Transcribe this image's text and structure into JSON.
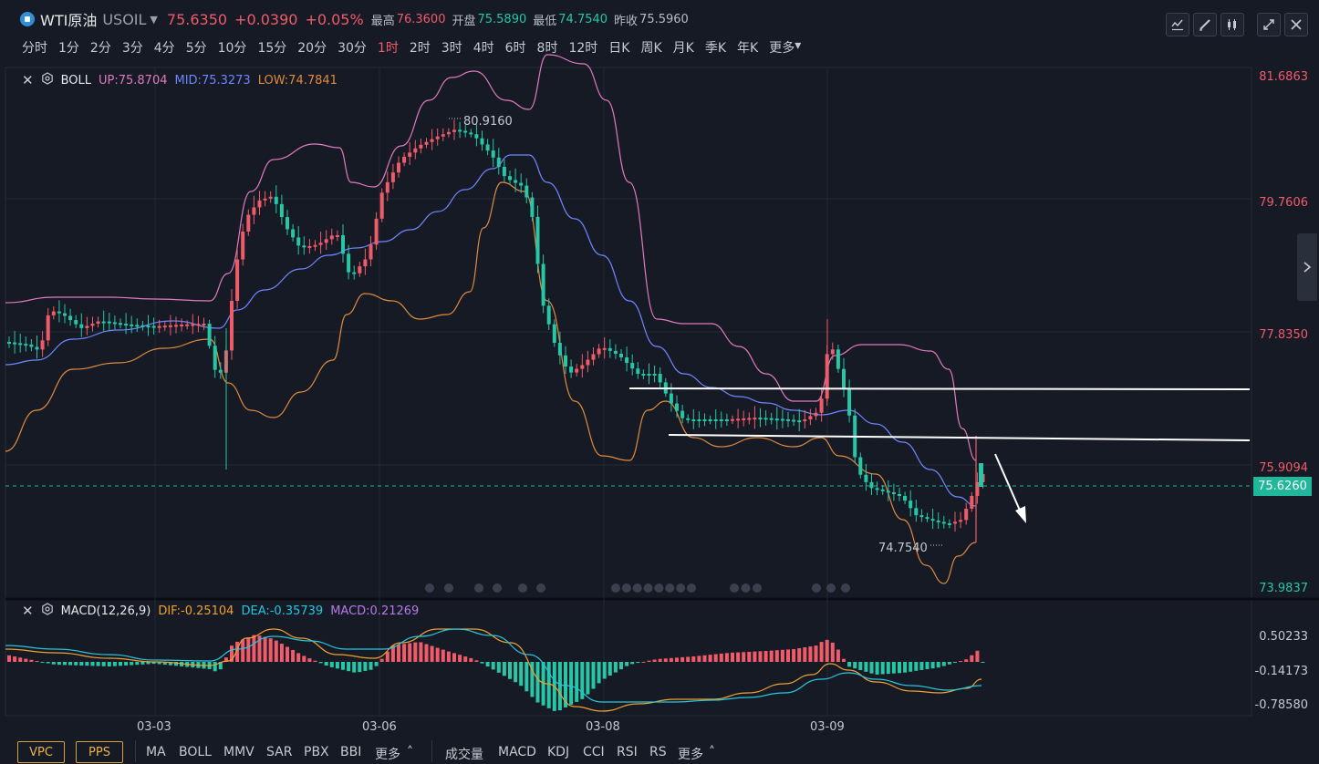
{
  "header": {
    "symbol_name": "WTI原油",
    "symbol_code": "USOIL",
    "price": "75.6350",
    "change": "+0.0390",
    "change_pct": "+0.05%",
    "high_label": "最高",
    "high_value": "76.3600",
    "open_label": "开盘",
    "open_value": "75.5890",
    "low_label": "最低",
    "low_value": "74.7540",
    "prev_close_label": "昨收",
    "prev_close_value": "75.5960"
  },
  "periods": [
    "分时",
    "1分",
    "2分",
    "3分",
    "4分",
    "5分",
    "10分",
    "15分",
    "20分",
    "30分",
    "1时",
    "2时",
    "3时",
    "4时",
    "6时",
    "8时",
    "12时",
    "日K",
    "周K",
    "月K",
    "季K",
    "年K",
    "更多"
  ],
  "active_period": "1时",
  "toolbar_icons": [
    "chart-type-icon",
    "draw-icon",
    "candle-settings-icon",
    "fullscreen-icon",
    "close-icon"
  ],
  "boll": {
    "name": "BOLL",
    "up": "UP:75.8704",
    "mid": "MID:75.3273",
    "low": "LOW:74.7841",
    "up_color": "#e07ac0",
    "mid_color": "#6f86ff",
    "low_color": "#e08a3c"
  },
  "price_axis": [
    "81.6863",
    "79.7606",
    "77.8350",
    "75.9094",
    "73.9837"
  ],
  "current_price_tag": "75.6260",
  "annotations": {
    "high_mark": "80.9160",
    "low_mark": "74.7540"
  },
  "macd": {
    "name": "MACD(12,26,9)",
    "dif": "DIF:-0.25104",
    "dea": "DEA:-0.35739",
    "macd": "MACD:0.21269",
    "dif_color": "#f0a030",
    "dea_color": "#26c6e0",
    "macd_color": "#b57be8",
    "axis": [
      "0.50233",
      "-0.14173",
      "-0.78580"
    ]
  },
  "time_axis": [
    "03-03",
    "03-06",
    "03-08",
    "03-09"
  ],
  "bottom": {
    "vpc": "VPC",
    "pps": "PPS",
    "main_indicators": [
      "MA",
      "BOLL",
      "MMV",
      "SAR",
      "PBX",
      "BBI",
      "更多"
    ],
    "sub_indicators": [
      "成交量",
      "MACD",
      "KDJ",
      "CCI",
      "RSI",
      "RS",
      "更多"
    ]
  },
  "colors": {
    "up": "#f05b6a",
    "down": "#26c6a6",
    "bg": "#161a25",
    "grid": "#232837"
  }
}
